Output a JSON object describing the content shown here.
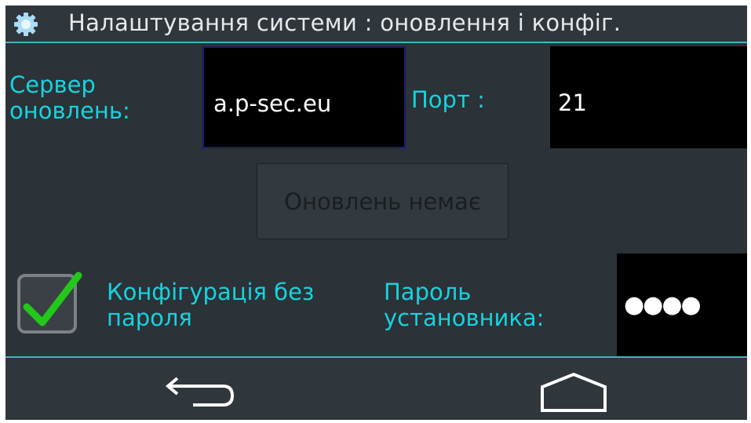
{
  "header": {
    "title": "Налаштування системи : оновлення і конфіг.",
    "icon": "gear-icon"
  },
  "server": {
    "label": "Сервер оновлень:",
    "value": "a.p-sec.eu"
  },
  "port": {
    "label": "Порт :",
    "value": "21"
  },
  "update_button": {
    "label": "Оновлень немає"
  },
  "config_checkbox": {
    "label": "Конфігурація без пароля",
    "checked": true,
    "icon": "checkmark-icon"
  },
  "installer_password": {
    "label": "Пароль установника:",
    "masked_value": "●●●●"
  },
  "navbar": {
    "back_icon": "back-arrow-icon",
    "home_icon": "home-icon"
  },
  "colors": {
    "background": "#2b3238",
    "accent": "#17d3dd",
    "divider": "#3fb6c0",
    "field_bg": "#000000",
    "check": "#22c81a"
  }
}
